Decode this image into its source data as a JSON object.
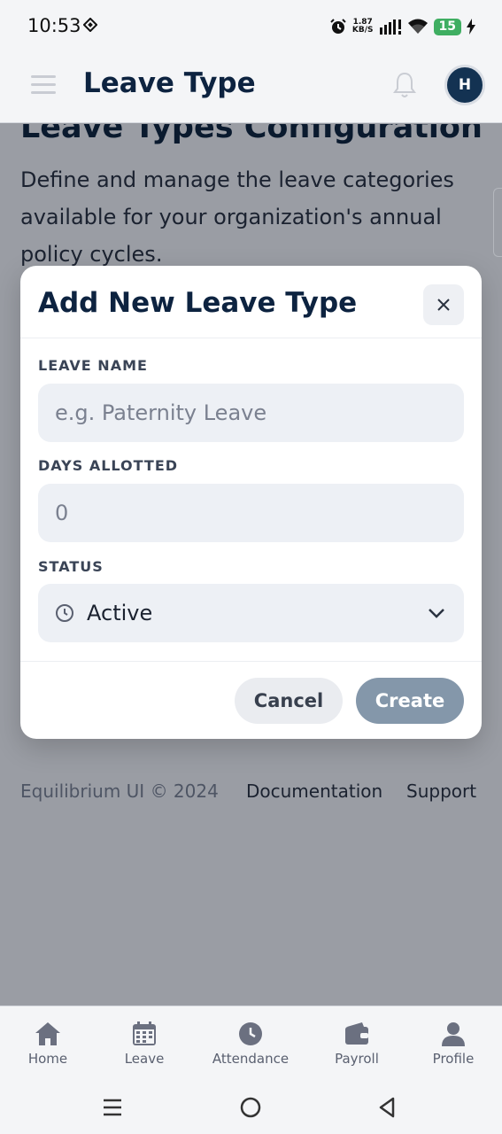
{
  "status_bar": {
    "time": "10:53",
    "net_speed_value": "1.87",
    "net_speed_unit": "KB/S",
    "battery": "15"
  },
  "header": {
    "title": "Leave Type",
    "avatar_initial": "H"
  },
  "page": {
    "heading": "Leave Types Configuration",
    "description": "Define and manage the leave categories available for your organization's annual policy cycles."
  },
  "modal": {
    "title": "Add New Leave Type",
    "fields": {
      "leave_name": {
        "label": "LEAVE NAME",
        "placeholder": "e.g. Paternity Leave",
        "value": ""
      },
      "days_allotted": {
        "label": "DAYS ALLOTTED",
        "placeholder": "0",
        "value": ""
      },
      "status": {
        "label": "STATUS",
        "selected": "Active"
      }
    },
    "buttons": {
      "cancel": "Cancel",
      "create": "Create"
    }
  },
  "footer": {
    "copyright": "Equilibrium UI © 2024",
    "links": [
      "Documentation",
      "Support"
    ]
  },
  "bottom_nav": [
    {
      "label": "Home",
      "icon": "home-icon"
    },
    {
      "label": "Leave",
      "icon": "calendar-icon"
    },
    {
      "label": "Attendance",
      "icon": "clock-icon"
    },
    {
      "label": "Payroll",
      "icon": "wallet-icon"
    },
    {
      "label": "Profile",
      "icon": "person-icon"
    }
  ],
  "colors": {
    "brand_navy": "#0d2340",
    "overlay": "#9a9da4",
    "create_button": "#8497aa",
    "battery_green": "#3fae62"
  }
}
